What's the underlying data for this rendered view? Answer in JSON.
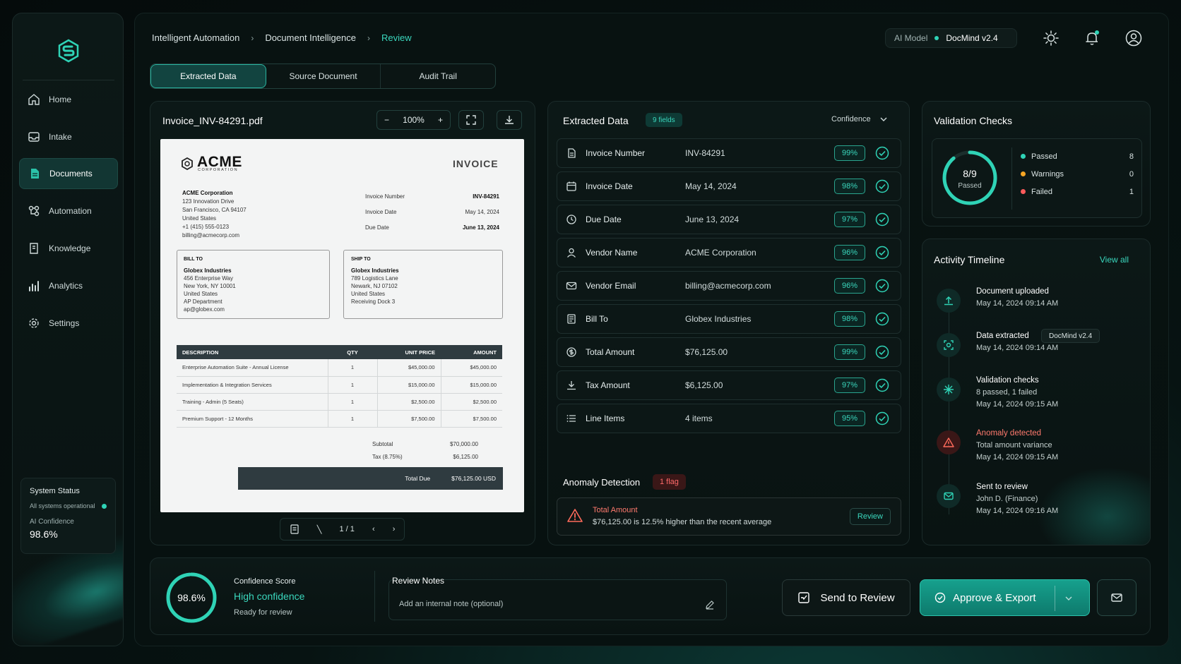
{
  "colors": {
    "accent": "#2fd3b6",
    "warning": "#f5a524",
    "danger": "#ff5b5b",
    "bg": "#071110"
  },
  "sidebar": {
    "items": [
      {
        "label": "Home",
        "icon": "home-icon"
      },
      {
        "label": "Intake",
        "icon": "inbox-icon"
      },
      {
        "label": "Documents",
        "icon": "document-icon",
        "active": true
      },
      {
        "label": "Automation",
        "icon": "workflow-icon"
      },
      {
        "label": "Knowledge",
        "icon": "book-icon"
      },
      {
        "label": "Analytics",
        "icon": "bar-chart-icon"
      },
      {
        "label": "Settings",
        "icon": "gear-icon"
      }
    ],
    "system_status": {
      "title": "System Status",
      "status": "All systems operational",
      "confidence_label": "AI Confidence",
      "confidence_value": "98.6%"
    }
  },
  "header": {
    "breadcrumbs": [
      "Intelligent Automation",
      "Document Intelligence",
      "Review"
    ],
    "model_label": "AI Model",
    "model_value": "DocMind v2.4"
  },
  "tabs": [
    "Extracted Data",
    "Source Document",
    "Audit Trail"
  ],
  "viewer": {
    "file_name": "Invoice_INV-84291.pdf",
    "zoom": "100%",
    "page": "1 / 1"
  },
  "invoice": {
    "logo": "ACME",
    "logo_sub": "CORPORATION",
    "heading": "INVOICE",
    "from": [
      "ACME Corporation",
      "123 Innovation Drive",
      "San Francisco, CA 94107",
      "United States",
      "+1 (415) 555-0123",
      "billing@acmecorp.com"
    ],
    "meta": [
      {
        "label": "Invoice Number",
        "value": "INV-84291"
      },
      {
        "label": "Invoice Date",
        "value": "May 14, 2024"
      },
      {
        "label": "Due Date",
        "value": "June 13, 2024"
      }
    ],
    "bill_to_title": "BILL TO",
    "bill_to": [
      "Globex Industries",
      "456 Enterprise Way",
      "New York, NY 10001",
      "United States",
      "AP Department",
      "ap@globex.com"
    ],
    "ship_to_title": "SHIP TO",
    "ship_to": [
      "Globex Industries",
      "789 Logistics Lane",
      "Newark, NJ 07102",
      "United States",
      "Receiving Dock 3"
    ],
    "columns": [
      "DESCRIPTION",
      "QTY",
      "UNIT PRICE",
      "AMOUNT"
    ],
    "rows": [
      [
        "Enterprise Automation Suite - Annual License",
        "1",
        "$45,000.00",
        "$45,000.00"
      ],
      [
        "Implementation & Integration Services",
        "1",
        "$15,000.00",
        "$15,000.00"
      ],
      [
        "Training - Admin (5 Seats)",
        "1",
        "$2,500.00",
        "$2,500.00"
      ],
      [
        "Premium Support - 12 Months",
        "1",
        "$7,500.00",
        "$7,500.00"
      ]
    ],
    "subtotal_label": "Subtotal",
    "subtotal": "$70,000.00",
    "tax_label": "Tax (8.75%)",
    "tax": "$6,125.00",
    "total_label": "Total Due",
    "total": "$76,125.00 USD"
  },
  "extracted": {
    "title": "Extracted Data",
    "fields_badge": "9 fields",
    "sort_label": "Confidence",
    "fields": [
      {
        "label": "Invoice Number",
        "value": "INV-84291",
        "conf": "99%",
        "icon": "document-icon"
      },
      {
        "label": "Invoice Date",
        "value": "May 14, 2024",
        "conf": "98%",
        "icon": "calendar-icon"
      },
      {
        "label": "Due Date",
        "value": "June 13, 2024",
        "conf": "97%",
        "icon": "clock-icon"
      },
      {
        "label": "Vendor Name",
        "value": "ACME Corporation",
        "conf": "96%",
        "icon": "user-icon"
      },
      {
        "label": "Vendor Email",
        "value": "billing@acmecorp.com",
        "conf": "96%",
        "icon": "mail-icon"
      },
      {
        "label": "Bill To",
        "value": "Globex Industries",
        "conf": "98%",
        "icon": "receipt-icon"
      },
      {
        "label": "Total Amount",
        "value": "$76,125.00",
        "conf": "99%",
        "icon": "money-icon"
      },
      {
        "label": "Tax Amount",
        "value": "$6,125.00",
        "conf": "97%",
        "icon": "tax-icon"
      },
      {
        "label": "Line Items",
        "value": "4 items",
        "conf": "95%",
        "icon": "list-icon"
      }
    ],
    "anomaly_title": "Anomaly Detection",
    "anomaly_flag": "1 flag",
    "anomaly": {
      "title": "Total Amount",
      "desc": "$76,125.00 is 12.5% higher than the recent average",
      "action": "Review"
    }
  },
  "validation": {
    "title": "Validation Checks",
    "ratio": "8/9",
    "ratio_label": "Passed",
    "progress": 0.889,
    "items": [
      {
        "label": "Passed",
        "count": "8",
        "color": "#2fd3b6"
      },
      {
        "label": "Warnings",
        "count": "0",
        "color": "#f5a524"
      },
      {
        "label": "Failed",
        "count": "1",
        "color": "#ff5b5b"
      }
    ]
  },
  "activity": {
    "title": "Activity Timeline",
    "view_all": "View all",
    "items": [
      {
        "title": "Document uploaded",
        "sub": "",
        "date": "May 14, 2024 09:14 AM",
        "icon": "upload-icon"
      },
      {
        "title": "Data extracted",
        "sub": "",
        "badge": "DocMind v2.4",
        "date": "May 14, 2024 09:14 AM",
        "icon": "scan-icon"
      },
      {
        "title": "Validation checks",
        "sub": "8 passed, 1 failed",
        "date": "May 14, 2024 09:15 AM",
        "icon": "sparkle-icon"
      },
      {
        "title": "Anomaly detected",
        "sub": "Total amount variance",
        "date": "May 14, 2024 09:15 AM",
        "icon": "warning-icon",
        "danger": true
      },
      {
        "title": "Sent to review",
        "sub": "John D. (Finance)",
        "date": "May 14, 2024 09:16 AM",
        "icon": "mail-icon"
      }
    ]
  },
  "bottom": {
    "score": "98.6%",
    "score_progress": 0.986,
    "score_label": "Confidence Score",
    "score_level": "High confidence",
    "score_status": "Ready for review",
    "notes_label": "Review Notes",
    "notes_placeholder": "Add an internal note (optional)",
    "send_review": "Send to Review",
    "approve": "Approve & Export"
  }
}
